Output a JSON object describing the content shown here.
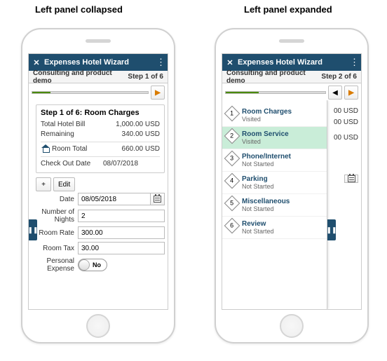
{
  "captions": {
    "left": "Left panel collapsed",
    "right": "Left panel expanded"
  },
  "collapsed": {
    "appbar_title": "Expenses Hotel Wizard",
    "subtitle": "Consulting and product demo",
    "step_label": "Step 1 of 6",
    "card_heading": "Step 1 of 6: Room Charges",
    "rows": {
      "total_bill_k": "Total Hotel Bill",
      "total_bill_v": "1,000.00 USD",
      "remaining_k": "Remaining",
      "remaining_v": "340.00 USD",
      "room_total_k": "Room Total",
      "room_total_v": "660.00 USD",
      "checkout_k": "Check Out Date",
      "checkout_v": "08/07/2018"
    },
    "toolbar": {
      "add": "+",
      "edit": "Edit"
    },
    "form": {
      "date_label": "Date",
      "date_value": "08/05/2018",
      "nights_label": "Number of Nights",
      "nights_value": "2",
      "rate_label": "Room Rate",
      "rate_value": "300.00",
      "tax_label": "Room Tax",
      "tax_value": "30.00",
      "personal_label": "Personal Expense",
      "personal_value": "No"
    }
  },
  "expanded": {
    "appbar_title": "Expenses Hotel Wizard",
    "subtitle": "Consulting and product demo",
    "step_label": "Step 2 of 6",
    "bg": {
      "val1": "00 USD",
      "val2": "00 USD",
      "val3": "00 USD"
    },
    "steps": [
      {
        "num": "1",
        "name": "Room Charges",
        "status": "Visited"
      },
      {
        "num": "2",
        "name": "Room Service",
        "status": "Visited"
      },
      {
        "num": "3",
        "name": "Phone/Internet",
        "status": "Not Started"
      },
      {
        "num": "4",
        "name": "Parking",
        "status": "Not Started"
      },
      {
        "num": "5",
        "name": "Miscellaneous",
        "status": "Not Started"
      },
      {
        "num": "6",
        "name": "Review",
        "status": "Not Started"
      }
    ]
  }
}
